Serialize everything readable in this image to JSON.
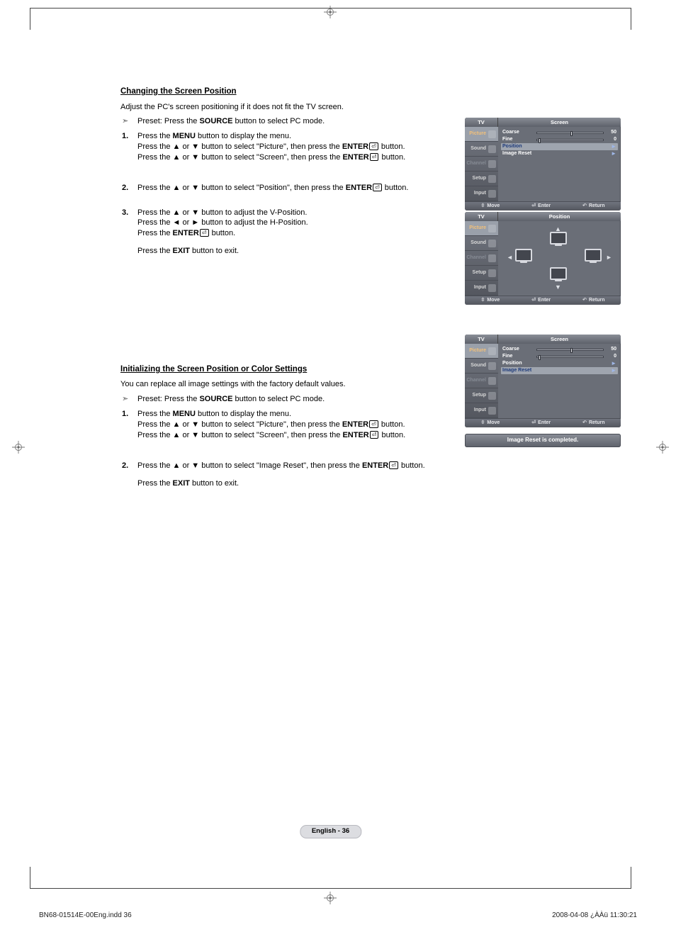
{
  "section1": {
    "heading": "Changing the Screen Position",
    "intro": "Adjust the PC's screen positioning if it does not fit the TV screen.",
    "preset": "Preset: Press the SOURCE button to select PC mode.",
    "steps": [
      {
        "line1": "Press the MENU button to display the menu.",
        "line2": "Press the ▲ or ▼ button to select \"Picture\", then press the ENTER button.",
        "line3": "Press the ▲ or ▼ button to select \"Screen\", then press the ENTER button."
      },
      {
        "line1": "Press the ▲ or ▼ button to select \"Position\", then press the ENTER button."
      },
      {
        "line1": "Press the ▲ or ▼ button to adjust the V-Position.",
        "line2": "Press the ◄ or ► button to adjust the H-Position.",
        "line3": "Press the ENTER button.",
        "exit": "Press the EXIT button to exit."
      }
    ]
  },
  "section2": {
    "heading": "Initializing the Screen Position or Color Settings",
    "intro": "You can replace all image settings with the factory default values.",
    "preset": "Preset: Press the SOURCE button to select PC mode.",
    "steps": [
      {
        "line1": "Press the MENU button to display the menu.",
        "line2": "Press the ▲ or ▼ button to select \"Picture\", then press the ENTER button.",
        "line3": "Press the ▲ or ▼ button to select \"Screen\", then press the ENTER button."
      },
      {
        "line1": "Press the ▲ or ▼ button to select \"Image Reset\", then press the ENTER button.",
        "exit": "Press the EXIT button to exit."
      }
    ]
  },
  "osd": {
    "tv": "TV",
    "title_screen": "Screen",
    "title_position": "Position",
    "tabs": {
      "picture": "Picture",
      "sound": "Sound",
      "channel": "Channel",
      "setup": "Setup",
      "input": "Input"
    },
    "rows": {
      "coarse": "Coarse",
      "fine": "Fine",
      "position": "Position",
      "imageReset": "Image Reset",
      "val50": "50",
      "val0": "0",
      "arrow": "►"
    },
    "footer": {
      "move": "Move",
      "enter": "Enter",
      "return": "Return"
    },
    "msg": "Image Reset is completed."
  },
  "page": {
    "num": "English - 36",
    "left": "BN68-01514E-00Eng.indd   36",
    "right": "2008-04-08   ¿ÀÀü 11:30:21"
  }
}
